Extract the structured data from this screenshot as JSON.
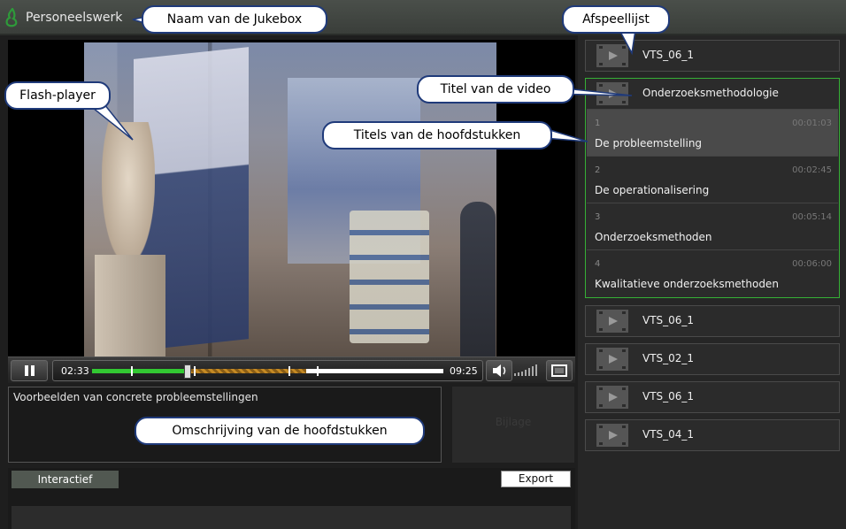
{
  "app": {
    "title": "Personeelswerk",
    "logo_icon": "green-logo-icon",
    "accent_color": "#36b036"
  },
  "player": {
    "elapsed": "02:33",
    "duration": "09:25",
    "played_fraction": 0.27,
    "loaded_fraction": 0.61,
    "pause_icon": "pause-icon",
    "volume_icon": "speaker-icon",
    "fullscreen_icon": "fullscreen-icon"
  },
  "description": {
    "text": "Voorbeelden van concrete probleemstellingen"
  },
  "bijlage": {
    "label": "Bijlage"
  },
  "tabs": {
    "interactive_label": "Interactief",
    "export_label": "Export"
  },
  "playlist": {
    "items_before": [
      {
        "label": "VTS_06_1"
      }
    ],
    "active": {
      "title": "Onderzoeksmethodologie",
      "chapters": [
        {
          "num": "1",
          "time": "00:01:03",
          "title": "De probleemstelling"
        },
        {
          "num": "2",
          "time": "00:02:45",
          "title": "De operationalisering"
        },
        {
          "num": "3",
          "time": "00:05:14",
          "title": "Onderzoeksmethoden"
        },
        {
          "num": "4",
          "time": "00:06:00",
          "title": "Kwalitatieve onderzoeksmethoden"
        }
      ]
    },
    "items_after": [
      {
        "label": "VTS_06_1"
      },
      {
        "label": "VTS_02_1"
      },
      {
        "label": "VTS_06_1"
      },
      {
        "label": "VTS_04_1"
      }
    ]
  },
  "callouts": {
    "jukebox": "Naam van de Jukebox",
    "playlist": "Afspeellijst",
    "flash": "Flash-player",
    "video_title": "Titel van de video",
    "chapters": "Titels van de hoofdstukken",
    "description": "Omschrijving van de hoofdstukken"
  }
}
